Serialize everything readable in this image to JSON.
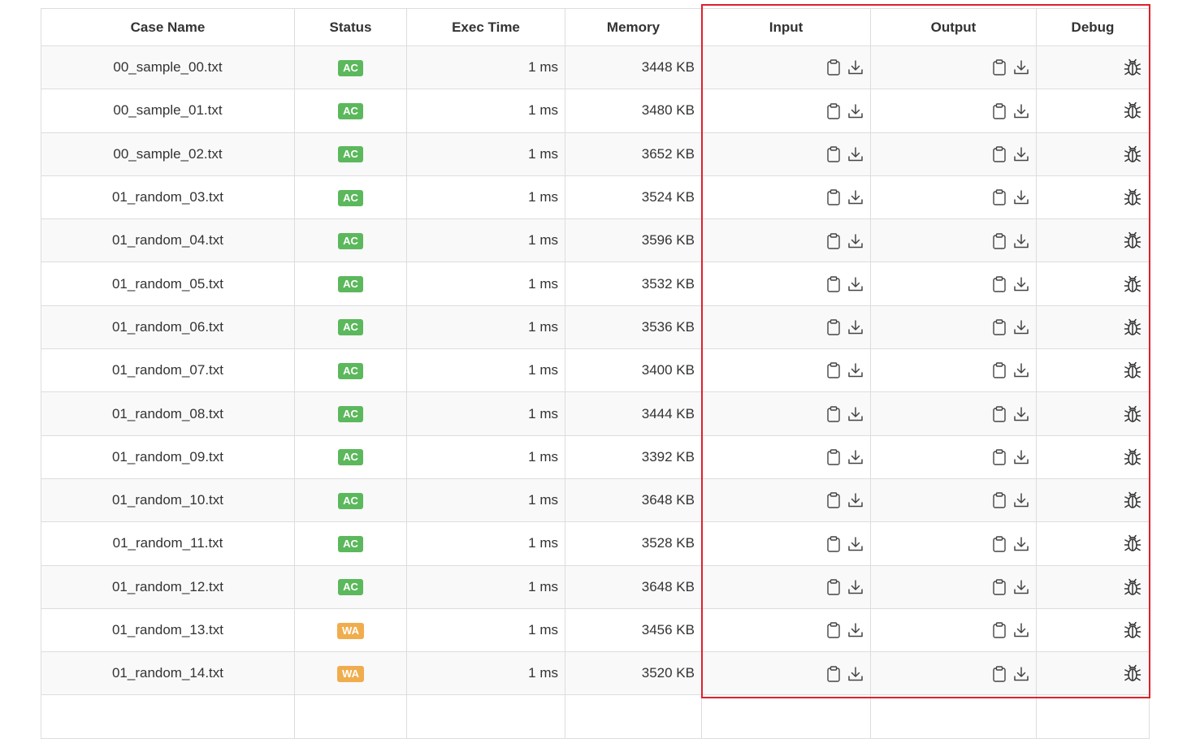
{
  "columns": {
    "case_name": "Case Name",
    "status": "Status",
    "exec_time": "Exec Time",
    "memory": "Memory",
    "input": "Input",
    "output": "Output",
    "debug": "Debug"
  },
  "colors": {
    "ac": "#5cb85c",
    "wa": "#f0ad4e",
    "highlight": "#e0202c"
  },
  "icons": [
    "clipboard-icon",
    "download-icon",
    "bug-icon"
  ],
  "rows": [
    {
      "name": "00_sample_00.txt",
      "status": "AC",
      "time": "1 ms",
      "memory": "3448 KB"
    },
    {
      "name": "00_sample_01.txt",
      "status": "AC",
      "time": "1 ms",
      "memory": "3480 KB"
    },
    {
      "name": "00_sample_02.txt",
      "status": "AC",
      "time": "1 ms",
      "memory": "3652 KB"
    },
    {
      "name": "01_random_03.txt",
      "status": "AC",
      "time": "1 ms",
      "memory": "3524 KB"
    },
    {
      "name": "01_random_04.txt",
      "status": "AC",
      "time": "1 ms",
      "memory": "3596 KB"
    },
    {
      "name": "01_random_05.txt",
      "status": "AC",
      "time": "1 ms",
      "memory": "3532 KB"
    },
    {
      "name": "01_random_06.txt",
      "status": "AC",
      "time": "1 ms",
      "memory": "3536 KB"
    },
    {
      "name": "01_random_07.txt",
      "status": "AC",
      "time": "1 ms",
      "memory": "3400 KB"
    },
    {
      "name": "01_random_08.txt",
      "status": "AC",
      "time": "1 ms",
      "memory": "3444 KB"
    },
    {
      "name": "01_random_09.txt",
      "status": "AC",
      "time": "1 ms",
      "memory": "3392 KB"
    },
    {
      "name": "01_random_10.txt",
      "status": "AC",
      "time": "1 ms",
      "memory": "3648 KB"
    },
    {
      "name": "01_random_11.txt",
      "status": "AC",
      "time": "1 ms",
      "memory": "3528 KB"
    },
    {
      "name": "01_random_12.txt",
      "status": "AC",
      "time": "1 ms",
      "memory": "3648 KB"
    },
    {
      "name": "01_random_13.txt",
      "status": "WA",
      "time": "1 ms",
      "memory": "3456 KB"
    },
    {
      "name": "01_random_14.txt",
      "status": "WA",
      "time": "1 ms",
      "memory": "3520 KB"
    }
  ]
}
